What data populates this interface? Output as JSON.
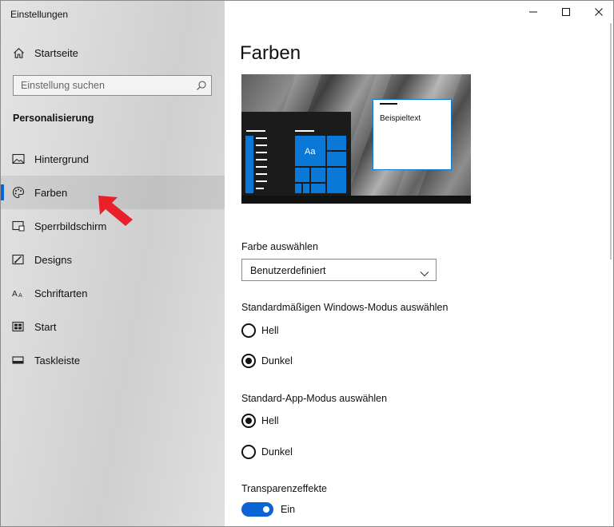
{
  "window": {
    "title": "Einstellungen"
  },
  "sidebar": {
    "home_label": "Startseite",
    "search_placeholder": "Einstellung suchen",
    "section_title": "Personalisierung",
    "items": [
      {
        "label": "Hintergrund",
        "icon": "picture-icon",
        "selected": false
      },
      {
        "label": "Farben",
        "icon": "palette-icon",
        "selected": true
      },
      {
        "label": "Sperrbildschirm",
        "icon": "lock-screen-icon",
        "selected": false
      },
      {
        "label": "Designs",
        "icon": "brush-icon",
        "selected": false
      },
      {
        "label": "Schriftarten",
        "icon": "font-icon",
        "selected": false
      },
      {
        "label": "Start",
        "icon": "start-icon",
        "selected": false
      },
      {
        "label": "Taskleiste",
        "icon": "taskbar-icon",
        "selected": false
      }
    ]
  },
  "main": {
    "title": "Farben",
    "preview": {
      "sample_text": "Beispieltext",
      "tile_text": "Aa"
    },
    "color_select": {
      "label": "Farbe auswählen",
      "value": "Benutzerdefiniert"
    },
    "windows_mode": {
      "label": "Standardmäßigen Windows-Modus auswählen",
      "options": [
        {
          "label": "Hell",
          "checked": false
        },
        {
          "label": "Dunkel",
          "checked": true
        }
      ]
    },
    "app_mode": {
      "label": "Standard-App-Modus auswählen",
      "options": [
        {
          "label": "Hell",
          "checked": true
        },
        {
          "label": "Dunkel",
          "checked": false
        }
      ]
    },
    "transparency": {
      "label": "Transparenzeffekte",
      "state_label": "Ein",
      "on": true
    }
  },
  "colors": {
    "accent": "#0a64d6",
    "tile_blue": "#0a78d7",
    "annotation_arrow": "#e8202a"
  }
}
